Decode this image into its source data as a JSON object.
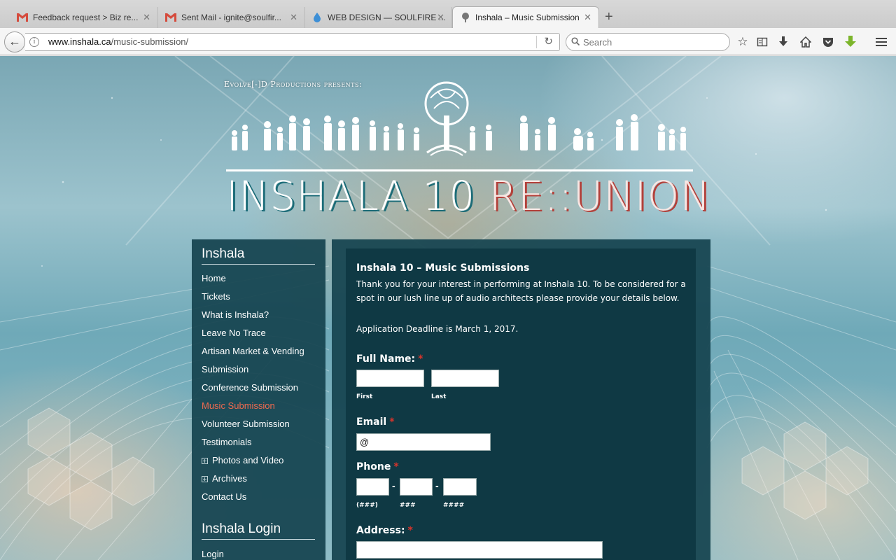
{
  "browser": {
    "tabs": [
      {
        "label": "Feedback request > Biz re...",
        "icon": "gmail-icon"
      },
      {
        "label": "Sent Mail - ignite@soulfir...",
        "icon": "gmail-icon"
      },
      {
        "label": "WEB DESIGN — SOULFIRE ...",
        "icon": "water-drop-icon"
      },
      {
        "label": "Inshala – Music Submission",
        "icon": "tree-icon",
        "active": true
      }
    ],
    "url_domain": "www.inshala.ca",
    "url_path": "/music-submission/",
    "search_placeholder": "Search"
  },
  "header": {
    "presents": "Evolve[-]D Productions presents:",
    "title_main": "INSHALA 10 ",
    "title_accent": "RE::UNION"
  },
  "sidebar": {
    "title": "Inshala",
    "items": [
      {
        "label": "Home"
      },
      {
        "label": "Tickets"
      },
      {
        "label": "What is Inshala?"
      },
      {
        "label": "Leave No Trace"
      },
      {
        "label": "Artisan Market & Vending"
      },
      {
        "label": "Submission"
      },
      {
        "label": "Conference Submission"
      },
      {
        "label": "Music Submission",
        "current": true
      },
      {
        "label": "Volunteer Submission"
      },
      {
        "label": "Testimonials"
      },
      {
        "label": "Photos and Video",
        "expandable": true
      },
      {
        "label": "Archives",
        "expandable": true
      },
      {
        "label": "Contact Us"
      }
    ],
    "login_title": "Inshala Login",
    "login_link": "Login"
  },
  "content": {
    "title": "Inshala 10 – Music Submissions",
    "intro_line1": "Thank you for your interest in performing at Inshala 10. To be considered for a",
    "intro_line2": "spot in our lush line up of audio architects please provide your details below.",
    "deadline": "Application Deadline is March 1, 2017.",
    "form": {
      "full_name_label": "Full Name:",
      "first_sub": "First",
      "last_sub": "Last",
      "email_label": "Email",
      "email_value": "@",
      "phone_label": "Phone",
      "phone_sub_area": "(###)",
      "phone_sub_prefix": "###",
      "phone_sub_line": "####",
      "phone_dash": "-",
      "address_label": "Address:",
      "required_mark": "*"
    }
  },
  "colors": {
    "panel": "#154450",
    "content_bg": "#0f3944",
    "current_link": "#f06a4f",
    "required": "#d9342b"
  }
}
